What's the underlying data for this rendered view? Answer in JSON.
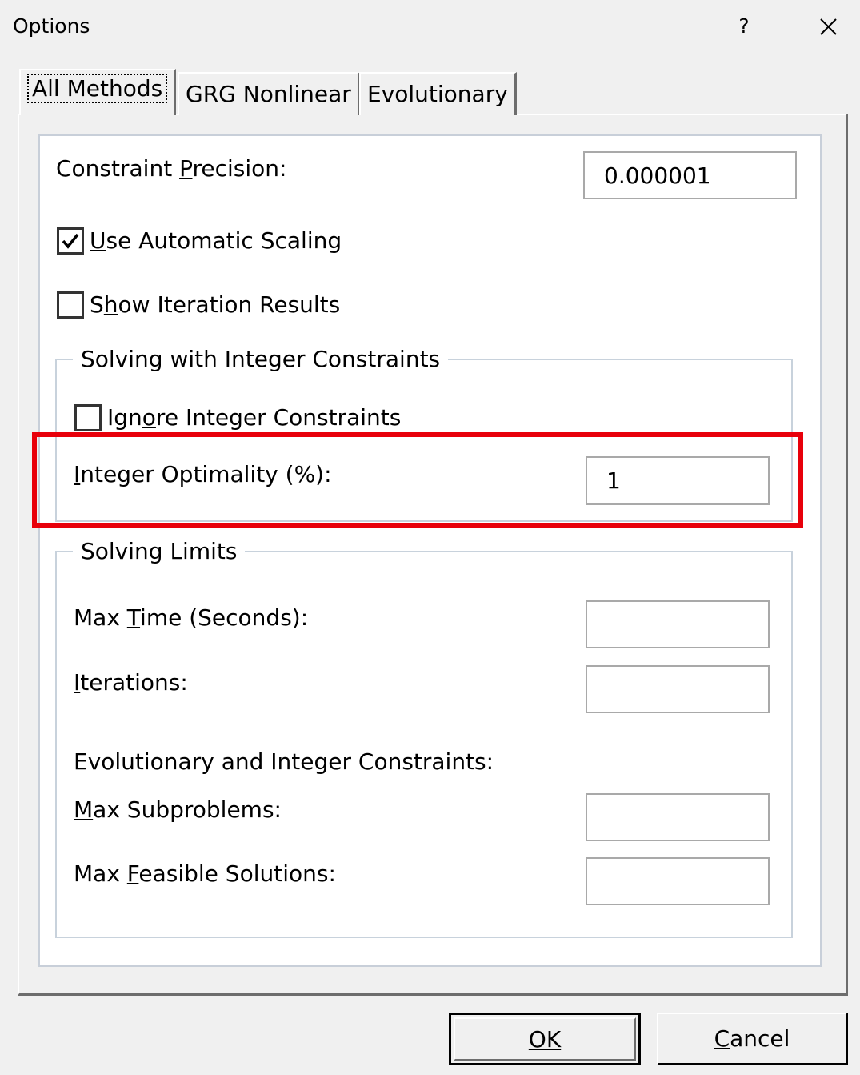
{
  "window": {
    "title": "Options",
    "help_label": "?"
  },
  "tabs": [
    {
      "label": "All Methods",
      "active": true
    },
    {
      "label": "GRG Nonlinear",
      "active": false
    },
    {
      "label": "Evolutionary",
      "active": false
    }
  ],
  "constraint_precision": {
    "label": "Constraint Precision:",
    "value": "0.000001"
  },
  "use_automatic_scaling": {
    "label": "Use Automatic Scaling",
    "checked": true
  },
  "show_iteration_results": {
    "label": "Show Iteration Results",
    "checked": false
  },
  "integer_group": {
    "title": "Solving with Integer Constraints",
    "ignore_label": "Ignore Integer Constraints",
    "ignore_checked": false,
    "optimality_label": "Integer Optimality (%):",
    "optimality_value": "1"
  },
  "limits_group": {
    "title": "Solving Limits",
    "max_time_label": "Max Time (Seconds):",
    "max_time_value": "",
    "iterations_label": "Iterations:",
    "iterations_value": "",
    "evolutionary_label": "Evolutionary and Integer Constraints:",
    "max_subproblems_label": "Max Subproblems:",
    "max_subproblems_value": "",
    "max_feasible_label": "Max Feasible Solutions:",
    "max_feasible_value": ""
  },
  "buttons": {
    "ok": "OK",
    "cancel": "Cancel"
  },
  "colors": {
    "highlight": "#e8000b",
    "dialog_bg": "#f0f0f0",
    "panel_bg": "#ffffff"
  }
}
